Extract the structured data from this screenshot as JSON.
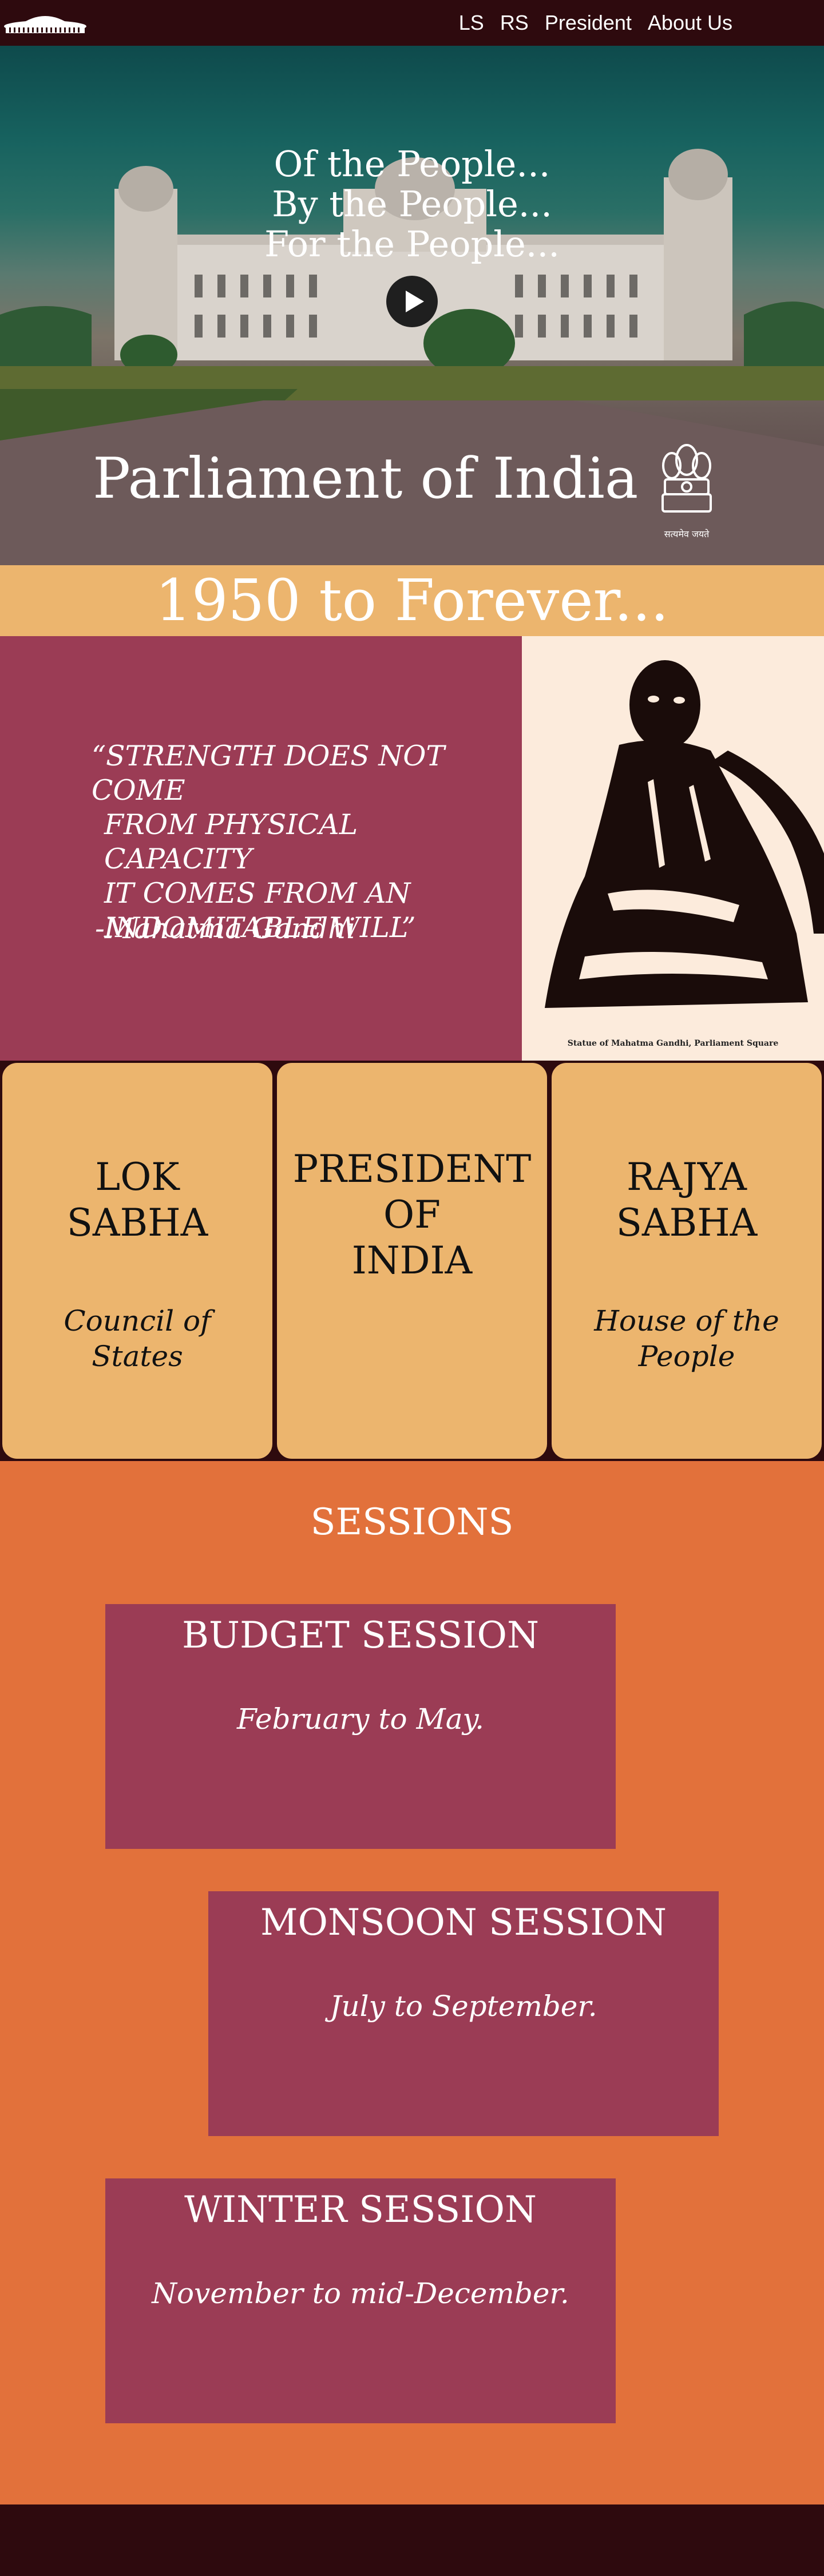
{
  "nav": {
    "links": [
      "LS",
      "RS",
      "President",
      "About Us"
    ]
  },
  "hero": {
    "motto": [
      "Of the People...",
      "By the People...",
      "For the People..."
    ],
    "title": "Parliament of India",
    "emblem_motto": "सत्यमेव जयते"
  },
  "banner": {
    "text": "1950 to Forever..."
  },
  "quote": {
    "lines": [
      "“STRENGTH DOES NOT COME",
      "FROM PHYSICAL CAPACITY",
      "IT COMES FROM AN",
      "INDOMITABLE WILL”"
    ],
    "author": "-Mahatma Gandhi",
    "image_caption": "Statue of Mahatma Gandhi, Parliament Square"
  },
  "cards": [
    {
      "title_lines": [
        "LOK",
        "SABHA"
      ],
      "subtitle_lines": [
        "Council of",
        "States"
      ]
    },
    {
      "title_lines": [
        "PRESIDENT",
        "OF",
        "INDIA"
      ],
      "subtitle_lines": []
    },
    {
      "title_lines": [
        "RAJYA",
        "SABHA"
      ],
      "subtitle_lines": [
        "House of the",
        "People"
      ]
    }
  ],
  "sessions": {
    "title": "SESSIONS",
    "items": [
      {
        "name": "BUDGET SESSION",
        "dates": "February to May."
      },
      {
        "name": "MONSOON SESSION",
        "dates": "July to September."
      },
      {
        "name": "WINTER SESSION",
        "dates": "November to mid-December."
      }
    ]
  },
  "colors": {
    "dark": "#2e0a0e",
    "gold": "#ecb56e",
    "maroon": "#9b3c55",
    "orange": "#e2713b"
  }
}
